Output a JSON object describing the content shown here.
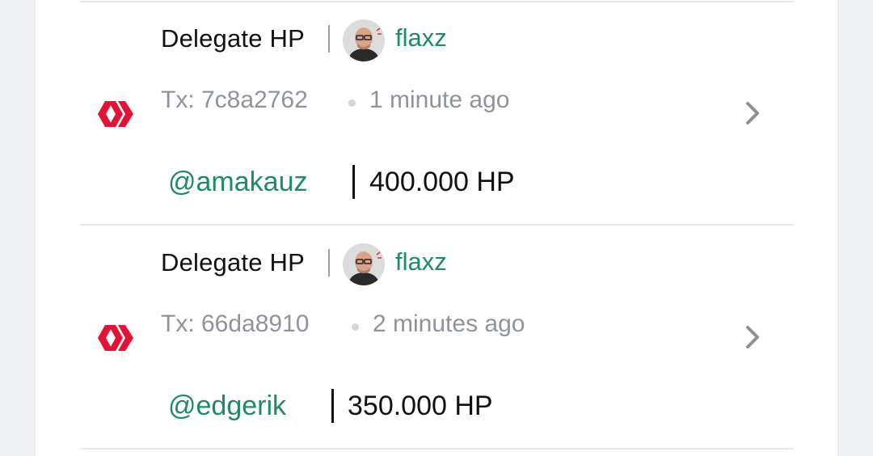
{
  "operations": [
    {
      "type_label": "Delegate HP",
      "author": "flaxz",
      "tx": "Tx: 7c8a2762",
      "time": "1 minute ago",
      "delegatee": "@amakauz",
      "amount": "400.000 HP"
    },
    {
      "type_label": "Delegate HP",
      "author": "flaxz",
      "tx": "Tx: 66da8910",
      "time": "2 minutes ago",
      "delegatee": "@edgerik",
      "amount": "350.000 HP"
    }
  ],
  "colors": {
    "link": "#1f8a6a",
    "hive_red": "#e31337",
    "muted": "#8f949a",
    "divider": "#e6e8eb"
  },
  "icons": {
    "op_icon": "hive-logo-icon",
    "nav_icon": "chevron-right-icon",
    "user_icon": "avatar"
  }
}
